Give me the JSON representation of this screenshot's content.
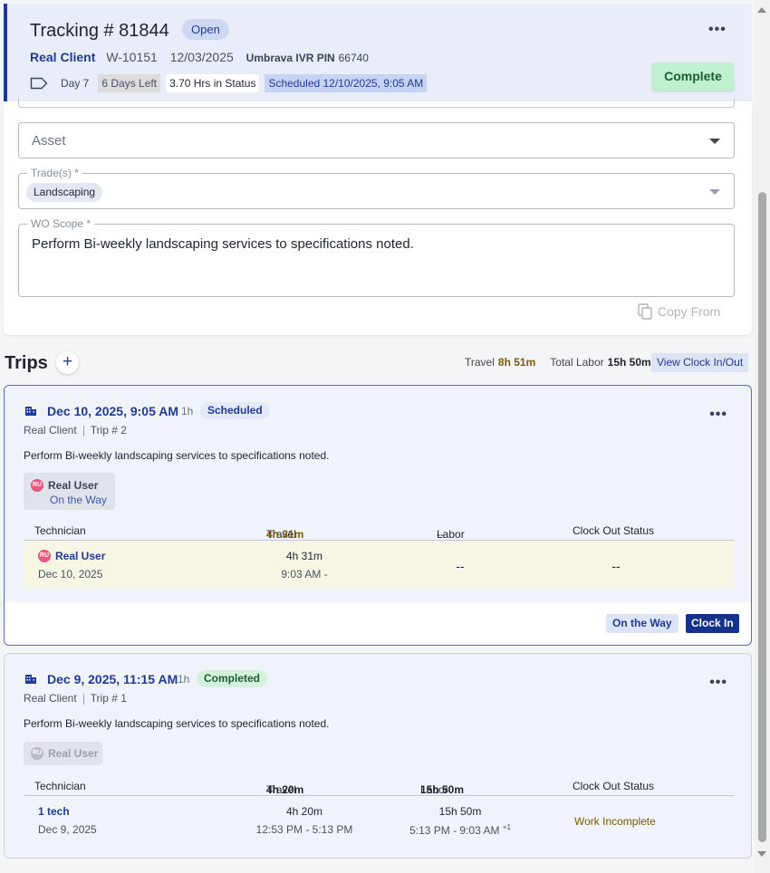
{
  "header": {
    "title": "Tracking # 81844",
    "status": "Open",
    "client": "Real Client",
    "wo_number": "W-10151",
    "date": "12/03/2025",
    "ivr_label": "Umbrava IVR PIN",
    "ivr_pin": "66740",
    "day": "Day 7",
    "days_left": "6 Days Left",
    "hrs_in_status": "3.70 Hrs in Status",
    "scheduled": "Scheduled 12/10/2025, 9:05 AM",
    "complete_button": "Complete"
  },
  "form": {
    "asset_placeholder": "Asset",
    "trades_label": "Trade(s) *",
    "trade_chip": "Landscaping",
    "scope_label": "WO Scope *",
    "scope_text": "Perform Bi-weekly landscaping services to specifications noted.",
    "copy_from": "Copy From"
  },
  "trips": {
    "title": "Trips",
    "add_label": "+",
    "travel_label": "Travel",
    "travel_value": "8h 51m",
    "total_labor_label": "Total Labor",
    "total_labor_value": "15h 50m",
    "view_clock_button": "View Clock In/Out",
    "items": [
      {
        "date": "Dec 10, 2025, 9:05 AM",
        "duration": "1h",
        "status": "Scheduled",
        "client": "Real Client",
        "trip_no": "Trip # 2",
        "description": "Perform Bi-weekly landscaping services to specifications noted.",
        "user_initials": "RU",
        "user_name": "Real User",
        "user_status": "On the Way",
        "columns": {
          "technician": "Technician",
          "travel": "Travel",
          "travel_value": "4h 31m",
          "labor": "Labor",
          "labor_value": "--",
          "clock_out": "Clock Out Status"
        },
        "row": {
          "technician": "Real User",
          "tech_date": "Dec 10, 2025",
          "travel": "4h 31m",
          "travel_range": "9:03 AM -",
          "labor": "--",
          "clock_out": "--"
        },
        "on_the_way_button": "On the Way",
        "clock_in_button": "Clock In"
      },
      {
        "date": "Dec 9, 2025, 11:15 AM",
        "duration": "1h",
        "status": "Completed",
        "client": "Real Client",
        "trip_no": "Trip # 1",
        "description": "Perform Bi-weekly landscaping services to specifications noted.",
        "user_initials": "RU",
        "user_name": "Real User",
        "columns": {
          "technician": "Technician",
          "travel": "Travel",
          "travel_value": "4h 20m",
          "labor": "Labor",
          "labor_value": "15h 50m",
          "clock_out": "Clock Out Status"
        },
        "row": {
          "technician": "1 tech",
          "tech_date": "Dec 9, 2025",
          "travel": "4h 20m",
          "travel_range": "12:53 PM - 5:13 PM",
          "labor": "15h 50m",
          "labor_range": "5:13 PM - 9:03 AM",
          "labor_sup": "+1",
          "clock_out": "Work Incomplete"
        }
      }
    ]
  },
  "colors": {
    "brand": "#1f3b93",
    "header_bg": "#e8edf9",
    "complete_bg": "#bff0cf",
    "gold": "#7a5b00",
    "highlight_row": "#f7f5e4"
  }
}
